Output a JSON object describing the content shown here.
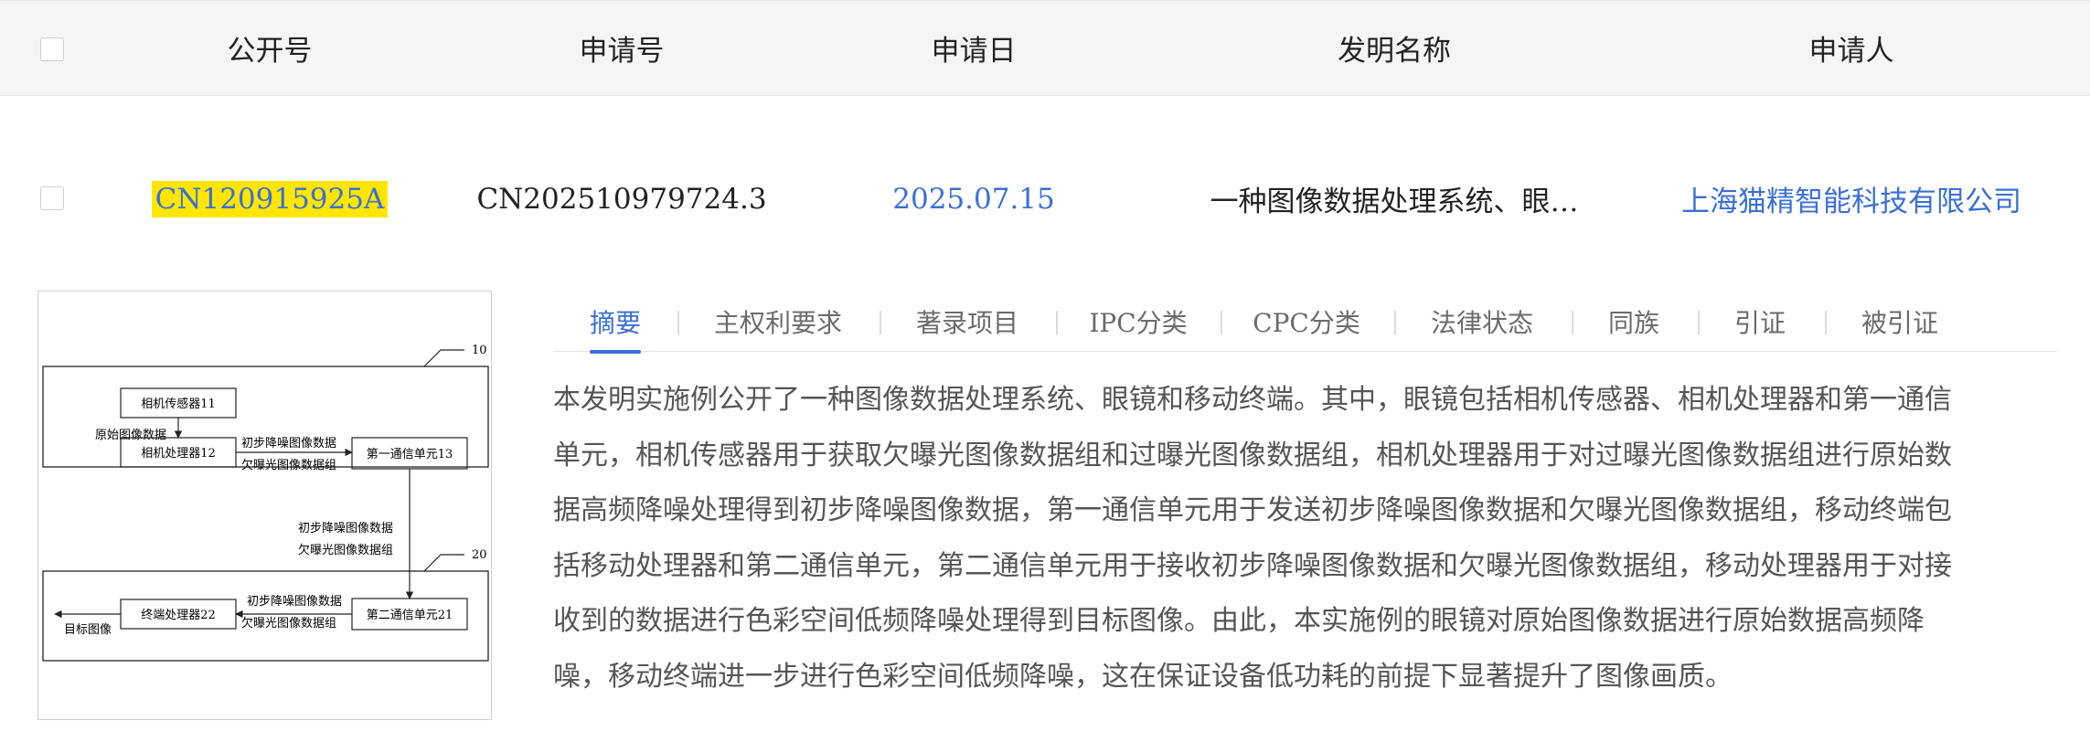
{
  "table": {
    "headers": {
      "publication_no": "公开号",
      "application_no": "申请号",
      "application_date": "申请日",
      "title": "发明名称",
      "applicant": "申请人"
    },
    "row": {
      "publication_no": "CN120915925A",
      "application_no": "CN202510979724.3",
      "application_date": "2025.07.15",
      "title": "一种图像数据处理系统、眼…",
      "applicant": "上海猫精智能科技有限公司"
    }
  },
  "figure": {
    "ref_10": "10",
    "ref_20": "20",
    "camera_sensor": "相机传感器11",
    "raw_data": "原始图像数据",
    "camera_processor": "相机处理器12",
    "denoise_data": "初步降噪图像数据",
    "under_exposed": "欠曝光图像数据组",
    "comm_unit_1": "第一通信单元13",
    "comm_unit_2": "第二通信单元21",
    "terminal_processor": "终端处理器22",
    "target_image": "目标图像"
  },
  "tabs": [
    {
      "label": "摘要",
      "active": true
    },
    {
      "label": "主权利要求",
      "active": false
    },
    {
      "label": "著录项目",
      "active": false
    },
    {
      "label": "IPC分类",
      "active": false
    },
    {
      "label": "CPC分类",
      "active": false
    },
    {
      "label": "法律状态",
      "active": false
    },
    {
      "label": "同族",
      "active": false
    },
    {
      "label": "引证",
      "active": false
    },
    {
      "label": "被引证",
      "active": false
    }
  ],
  "abstract": {
    "lines": [
      "本发明实施例公开了一种图像数据处理系统、眼镜和移动终端。其中，眼镜包括相机传感器、相机处理器和第一通信",
      "单元，相机传感器用于获取欠曝光图像数据组和过曝光图像数据组，相机处理器用于对过曝光图像数据组进行原始数",
      "据高频降噪处理得到初步降噪图像数据，第一通信单元用于发送初步降噪图像数据和欠曝光图像数据组，移动终端包",
      "括移动处理器和第二通信单元，第二通信单元用于接收初步降噪图像数据和欠曝光图像数据组，移动处理器用于对接",
      "收到的数据进行色彩空间低频降噪处理得到目标图像。由此，本实施例的眼镜对原始图像数据进行原始数据高频降",
      "噪，移动终端进一步进行色彩空间低频降噪，这在保证设备低功耗的前提下显著提升了图像画质。"
    ]
  },
  "colors": {
    "accent": "#3a6fd8",
    "highlight": "#ffe600",
    "header_bg": "#f5f5f5"
  }
}
